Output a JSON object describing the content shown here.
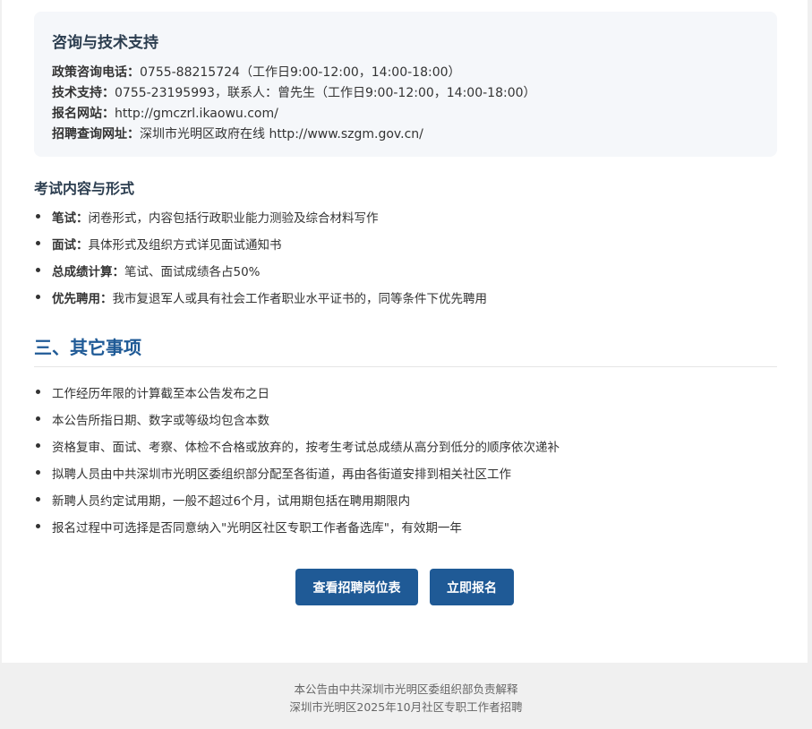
{
  "contact": {
    "title": "咨询与技术支持",
    "lines": [
      {
        "label": "政策咨询电话：",
        "value": "0755-88215724（工作日9:00-12:00，14:00-18:00）"
      },
      {
        "label": "技术支持：",
        "value": "0755-23195993，联系人：曾先生（工作日9:00-12:00，14:00-18:00）"
      },
      {
        "label": "报名网站：",
        "value": "http://gmczrl.ikaowu.com/"
      },
      {
        "label": "招聘查询网址：",
        "value": "深圳市光明区政府在线 http://www.szgm.gov.cn/"
      }
    ]
  },
  "exam": {
    "title": "考试内容与形式",
    "items": [
      {
        "label": "笔试：",
        "text": "闭卷形式，内容包括行政职业能力测验及综合材料写作"
      },
      {
        "label": "面试：",
        "text": "具体形式及组织方式详见面试通知书"
      },
      {
        "label": "总成绩计算：",
        "text": "笔试、面试成绩各占50%"
      },
      {
        "label": "优先聘用：",
        "text": "我市复退军人或具有社会工作者职业水平证书的，同等条件下优先聘用"
      }
    ]
  },
  "other": {
    "title": "三、其它事项",
    "items": [
      "工作经历年限的计算截至本公告发布之日",
      "本公告所指日期、数字或等级均包含本数",
      "资格复审、面试、考察、体检不合格或放弃的，按考生考试总成绩从高分到低分的顺序依次递补",
      "拟聘人员由中共深圳市光明区委组织部分配至各街道，再由各街道安排到相关社区工作",
      "新聘人员约定试用期，一般不超过6个月，试用期包括在聘用期限内",
      "报名过程中可选择是否同意纳入\"光明区社区专职工作者备选库\"，有效期一年"
    ]
  },
  "buttons": {
    "view_positions": "查看招聘岗位表",
    "apply_now": "立即报名"
  },
  "footer": {
    "line1": "本公告由中共深圳市光明区委组织部负责解释",
    "line2": "深圳市光明区2025年10月社区专职工作者招聘"
  },
  "colors": {
    "accent": "#1f5a96",
    "panel_bg": "#f5f7fa"
  }
}
